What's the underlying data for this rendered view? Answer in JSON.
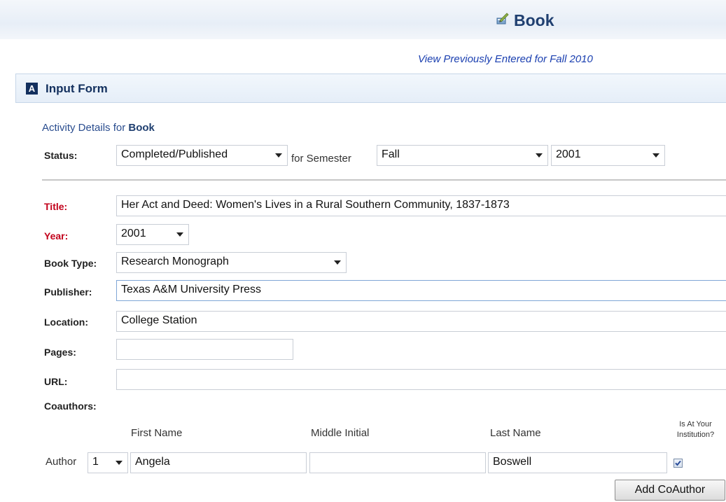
{
  "header": {
    "title": "Book",
    "icon": "pen-book-icon",
    "view_previous": "View Previously Entered for Fall 2010"
  },
  "form_panel": {
    "letter": "A",
    "label": "Input Form"
  },
  "activity": {
    "heading_prefix": "Activity Details for ",
    "heading_type": "Book"
  },
  "status_row": {
    "label": "Status:",
    "status_value": "Completed/Published",
    "for_semester_label": "for Semester",
    "semester_value": "Fall",
    "year_value": "2001"
  },
  "fields": {
    "title": {
      "label": "Title:",
      "value": "Her Act and Deed: Women's Lives in a Rural Southern Community, 1837-1873"
    },
    "year": {
      "label": "Year:",
      "value": "2001"
    },
    "book_type": {
      "label": "Book Type:",
      "value": "Research Monograph"
    },
    "publisher": {
      "label": "Publisher:",
      "value": "Texas A&M University Press"
    },
    "location": {
      "label": "Location:",
      "value": "College Station"
    },
    "pages": {
      "label": "Pages:",
      "value": ""
    },
    "url": {
      "label": "URL:",
      "value": ""
    }
  },
  "coauthors": {
    "label": "Coauthors:",
    "columns": {
      "first_name": "First Name",
      "middle_initial": "Middle Initial",
      "last_name": "Last Name",
      "institution_line1": "Is At Your",
      "institution_line2": "Institution?"
    },
    "author_label": "Author",
    "author_number": "1",
    "first_name": "Angela",
    "middle_initial": "",
    "last_name": "Boswell",
    "is_at_institution": true,
    "add_button": "Add CoAuthor"
  },
  "colors": {
    "accent": "#1f3f70",
    "link": "#1a3fb0",
    "required": "#c2001a"
  }
}
